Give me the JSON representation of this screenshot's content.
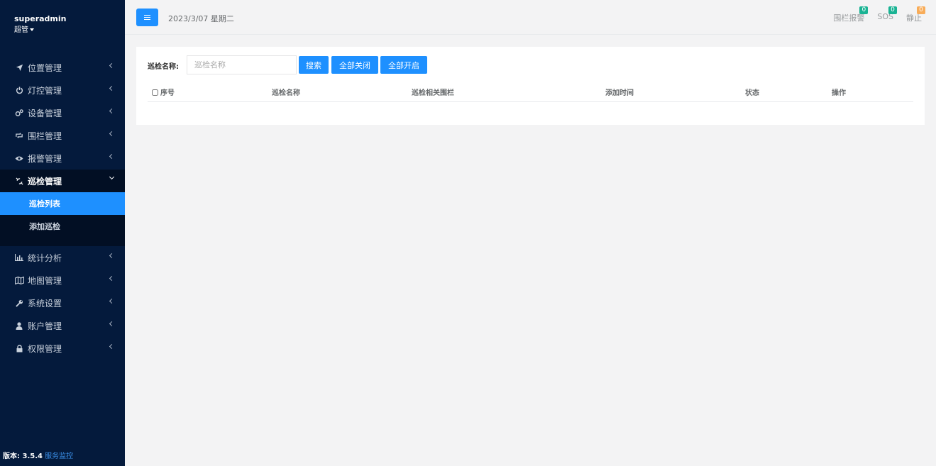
{
  "sidebar": {
    "username": "superadmin",
    "role": "超管",
    "menu": [
      {
        "label": "位置管理",
        "icon": "location-arrow-icon"
      },
      {
        "label": "灯控管理",
        "icon": "power-icon"
      },
      {
        "label": "设备管理",
        "icon": "cogs-icon"
      },
      {
        "label": "围栏管理",
        "icon": "retweet-icon"
      },
      {
        "label": "报警管理",
        "icon": "eye-icon"
      },
      {
        "label": "巡检管理",
        "icon": "unlink-icon"
      },
      {
        "label": "统计分析",
        "icon": "bar-chart-icon"
      },
      {
        "label": "地图管理",
        "icon": "map-icon"
      },
      {
        "label": "系统设置",
        "icon": "wrench-icon"
      },
      {
        "label": "账户管理",
        "icon": "user-icon"
      },
      {
        "label": "权限管理",
        "icon": "lock-icon"
      }
    ],
    "submenu": [
      {
        "label": "巡检列表"
      },
      {
        "label": "添加巡检"
      }
    ],
    "version_label": "版本: 3.5.4",
    "service_link": "服务监控"
  },
  "topbar": {
    "date": "2023/3/07 星期二",
    "links": [
      {
        "label": "围栏报警",
        "badge": "0",
        "badge_color": "#1ab394"
      },
      {
        "label": "SOS",
        "badge": "0",
        "badge_color": "#1ab394"
      },
      {
        "label": "静止",
        "badge": "0",
        "badge_color": "#f8ac59"
      }
    ]
  },
  "search": {
    "label": "巡检名称:",
    "placeholder": "巡检名称",
    "search_btn": "搜索",
    "close_all_btn": "全部关闭",
    "open_all_btn": "全部开启"
  },
  "table": {
    "columns": [
      "序号",
      "巡检名称",
      "巡检相关围栏",
      "添加时间",
      "状态",
      "操作"
    ]
  }
}
